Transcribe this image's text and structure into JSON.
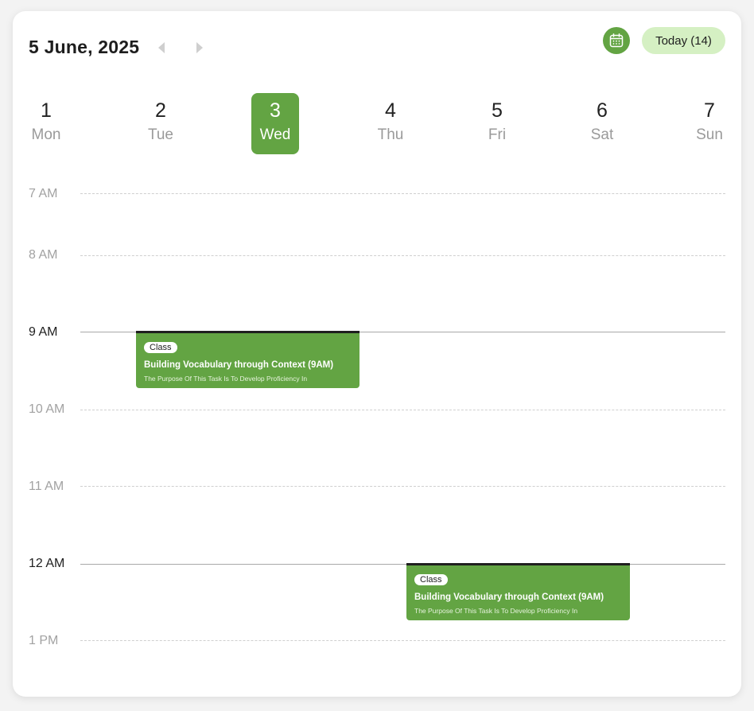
{
  "header": {
    "date_title": "5 June, 2025",
    "prev_icon": "chevron-left-icon",
    "next_icon": "chevron-right-icon",
    "calendar_icon": "calendar-icon",
    "today_label": "Today (14)"
  },
  "days": [
    {
      "num": "1",
      "name": "Mon"
    },
    {
      "num": "2",
      "name": "Tue"
    },
    {
      "num": "3",
      "name": "Wed",
      "selected": true
    },
    {
      "num": "4",
      "name": "Thu"
    },
    {
      "num": "5",
      "name": "Fri"
    },
    {
      "num": "6",
      "name": "Sat"
    },
    {
      "num": "7",
      "name": "Sun"
    }
  ],
  "times": [
    "7 AM",
    "8 AM",
    "9 AM",
    "10 AM",
    "11 AM",
    "12 AM",
    "1 PM"
  ],
  "events": [
    {
      "tag": "Class",
      "title": "Building Vocabulary through Context (9AM)",
      "description": "The Purpose Of This Task Is To Develop Proficiency In"
    },
    {
      "tag": "Class",
      "title": "Building Vocabulary through Context (9AM)",
      "description": "The Purpose Of This Task Is To Develop Proficiency In"
    }
  ],
  "colors": {
    "accent": "#63a443",
    "today_bg": "#d5f0c3"
  }
}
